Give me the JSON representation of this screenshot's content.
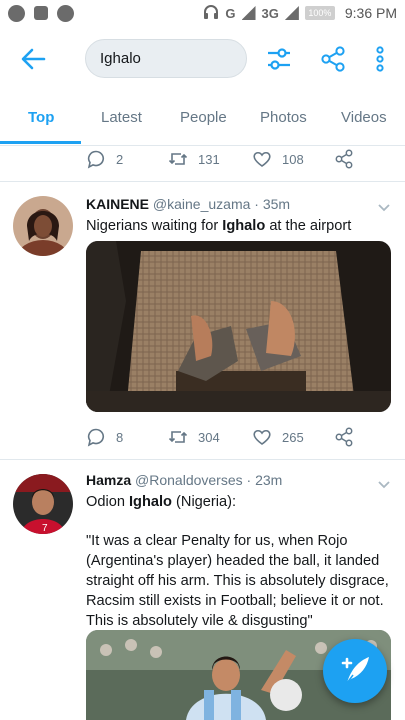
{
  "status_bar": {
    "network": "3G",
    "battery": "100%",
    "time": "9:36 PM"
  },
  "header": {
    "search_value": "Ighalo",
    "accent": "#1da1f2"
  },
  "tabs": [
    {
      "label": "Top",
      "active": true
    },
    {
      "label": "Latest"
    },
    {
      "label": "People"
    },
    {
      "label": "Photos"
    },
    {
      "label": "Videos"
    }
  ],
  "tweets": [
    {
      "replies": "2",
      "retweets": "131",
      "likes": "108"
    },
    {
      "name": "KAINENE",
      "handle": "@kaine_uzama",
      "time": "· 35m",
      "text_before": "Nigerians waiting for ",
      "text_bold": "Ighalo",
      "text_after": " at the airport",
      "replies": "8",
      "retweets": "304",
      "likes": "265"
    },
    {
      "name": "Hamza",
      "handle": "@Ronaldoverses",
      "time": "· 23m",
      "line1_before": "Odion ",
      "line1_bold": "Ighalo",
      "line1_after": " (Nigeria):",
      "quote": "\"It was a clear Penalty for us, when Rojo (Argentina's player) headed the ball, it landed straight off his arm. This is absolutely disgrace, Racsim still exists in Football; believe it or not. This is absolutely vile & disgusting\""
    }
  ],
  "icons": {
    "back": "arrow-left-icon",
    "filter": "filter-icon",
    "share": "share-icon",
    "more": "more-vertical-icon",
    "compose": "compose-tweet-icon"
  }
}
